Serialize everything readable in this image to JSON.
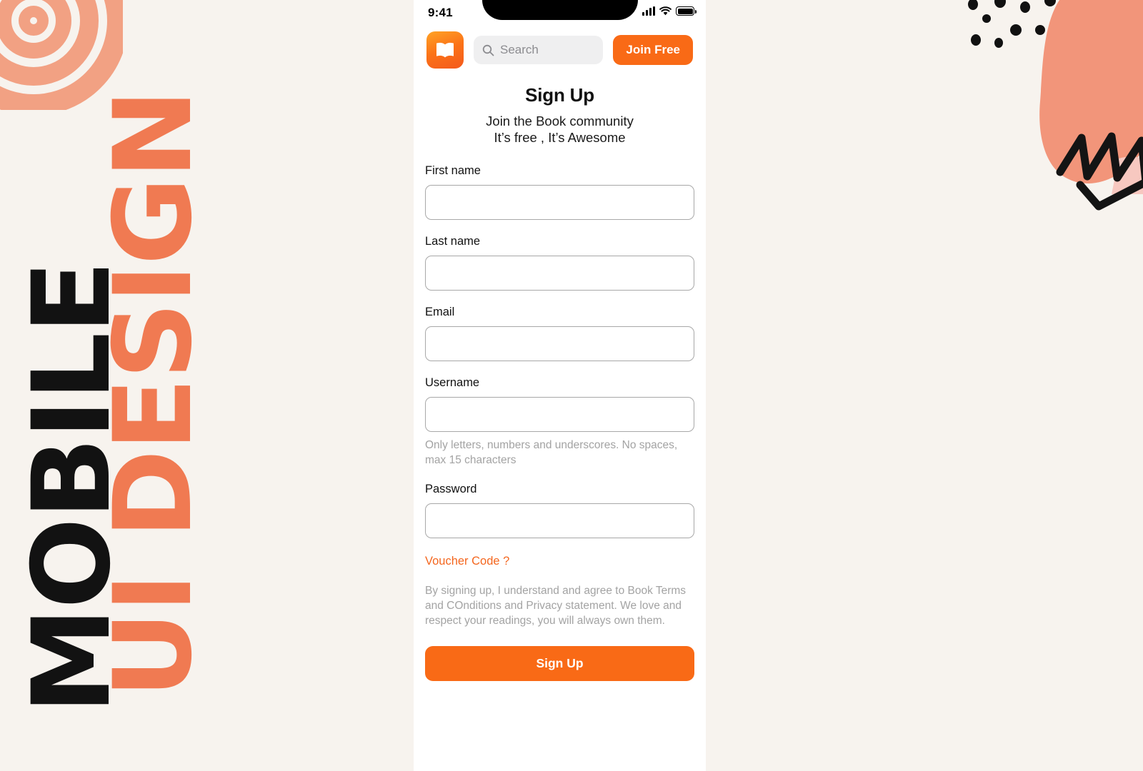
{
  "poster": {
    "vertical_text_primary": "UI DESIGN",
    "vertical_text_secondary": "MOBILE",
    "background_color": "#F7F3EE",
    "accent_color": "#F96A16",
    "decor_salmon": "#F2957A",
    "decor_pink": "#F7C8C0"
  },
  "phone": {
    "status_bar": {
      "time": "9:41",
      "cellular_icon": "signal-bars-icon",
      "wifi_icon": "wifi-icon",
      "battery_icon": "battery-icon"
    },
    "app_bar": {
      "logo_icon": "book-app-logo-icon",
      "search": {
        "icon": "search-icon",
        "placeholder": "Search",
        "value": ""
      },
      "join_free_label": "Join Free"
    },
    "header": {
      "title": "Sign Up",
      "subtitle_line1": "Join the Book community",
      "subtitle_line2": "It’s free , It’s Awesome"
    },
    "form": {
      "fields": [
        {
          "label": "First name",
          "value": "",
          "placeholder": "",
          "hint": "",
          "type": "text"
        },
        {
          "label": "Last name",
          "value": "",
          "placeholder": "",
          "hint": "",
          "type": "text"
        },
        {
          "label": "Email",
          "value": "",
          "placeholder": "",
          "hint": "",
          "type": "email"
        },
        {
          "label": "Username",
          "value": "",
          "placeholder": "",
          "hint": "Only letters, numbers and underscores. No spaces, max 15 characters",
          "type": "text"
        },
        {
          "label": "Password",
          "value": "",
          "placeholder": "",
          "hint": "",
          "type": "password"
        }
      ],
      "voucher_link_label": "Voucher Code ?",
      "terms_text": "By signing up, I understand and agree to Book Terms and COnditions and Privacy statement. We love and respect your readings, you will always own them.",
      "submit_label": "Sign Up"
    }
  }
}
